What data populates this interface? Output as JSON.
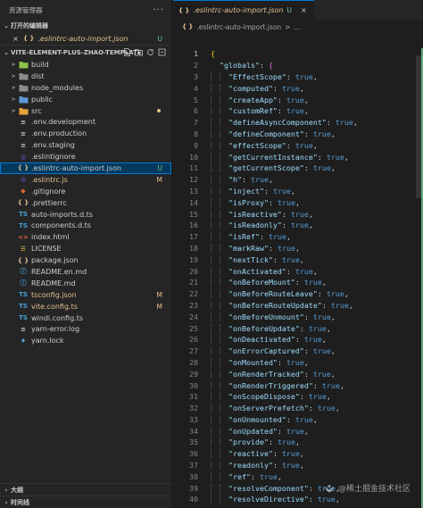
{
  "sidebar": {
    "title": "资源管理器",
    "more": "···",
    "open_editors_header": "打开的编辑器",
    "open_editors": [
      {
        "close": "×",
        "icon": "{ }",
        "label": ".eslintrc-auto-import.json",
        "badge": "U"
      }
    ],
    "project_header": "VITE-ELEMENT-PLUS-ZHAO-TEMPLATE",
    "tree": [
      {
        "label": "build",
        "type": "folder",
        "icon_color": "#8dc149",
        "arrow": ">"
      },
      {
        "label": "dist",
        "type": "folder",
        "icon_color": "#8c8c8c",
        "arrow": ">"
      },
      {
        "label": "node_modules",
        "type": "folder",
        "icon_color": "#8c8c8c",
        "arrow": ">"
      },
      {
        "label": "public",
        "type": "folder",
        "icon_color": "#5d9bd6",
        "arrow": ">"
      },
      {
        "label": "src",
        "type": "folder",
        "icon_color": "#e8a13c",
        "arrow": ">",
        "dot": true
      },
      {
        "label": ".env.development",
        "icon": "≡",
        "icon_color": "#cccccc"
      },
      {
        "label": ".env.production",
        "icon": "≡",
        "icon_color": "#cccccc"
      },
      {
        "label": ".env.staging",
        "icon": "≡",
        "icon_color": "#cccccc"
      },
      {
        "label": ".eslintignore",
        "icon": "◎",
        "icon_color": "#7b68ee"
      },
      {
        "label": ".eslintrc-auto-import.json",
        "icon": "{ }",
        "icon_color": "#e2c08d",
        "badge": "U",
        "selected": true
      },
      {
        "label": ".eslintrc.js",
        "icon": "◎",
        "icon_color": "#7b68ee",
        "badge": "M",
        "label_color": "#e2c08d"
      },
      {
        "label": ".gitignore",
        "icon": "◆",
        "icon_color": "#e8643c"
      },
      {
        "label": ".prettierrc",
        "icon": "{ }",
        "icon_color": "#e2c08d"
      },
      {
        "label": "auto-imports.d.ts",
        "icon": "TS",
        "icon_color": "#4a9fd6"
      },
      {
        "label": "components.d.ts",
        "icon": "TS",
        "icon_color": "#4a9fd6"
      },
      {
        "label": "index.html",
        "icon": "<>",
        "icon_color": "#e8643c"
      },
      {
        "label": "LICENSE",
        "icon": "☰",
        "icon_color": "#d8b448"
      },
      {
        "label": "package.json",
        "icon": "{ }",
        "icon_color": "#e2c08d"
      },
      {
        "label": "README.en.md",
        "icon": "ⓘ",
        "icon_color": "#4a9fd6"
      },
      {
        "label": "README.md",
        "icon": "ⓘ",
        "icon_color": "#4a9fd6"
      },
      {
        "label": "tsconfig.json",
        "icon": "TS",
        "icon_color": "#4a9fd6",
        "badge": "M",
        "label_color": "#e2c08d"
      },
      {
        "label": "vite.config.ts",
        "icon": "TS",
        "icon_color": "#4a9fd6",
        "badge": "M",
        "label_color": "#e2c08d"
      },
      {
        "label": "windi.config.ts",
        "icon": "TS",
        "icon_color": "#4a9fd6"
      },
      {
        "label": "yarn-error.log",
        "icon": "≡",
        "icon_color": "#cccccc"
      },
      {
        "label": "yarn.lock",
        "icon": "♦",
        "icon_color": "#4a9fd6"
      }
    ],
    "outline_header": "大纲",
    "timeline_header": "时间线"
  },
  "editor": {
    "tab": {
      "icon": "{ }",
      "label": ".eslintrc-auto-import.json",
      "badge": "U",
      "close": "×"
    },
    "breadcrumb": {
      "icon": "{ }",
      "label": ".eslintrc-auto-import.json",
      "sep": ">",
      "tail": "..."
    },
    "active_line": 1,
    "lines": [
      {
        "n": 1,
        "open": "{"
      },
      {
        "n": 2,
        "key": "\"globals\"",
        "open2": "{"
      },
      {
        "n": 3,
        "key": "\"EffectScope\"",
        "val": "true"
      },
      {
        "n": 4,
        "key": "\"computed\"",
        "val": "true"
      },
      {
        "n": 5,
        "key": "\"createApp\"",
        "val": "true"
      },
      {
        "n": 6,
        "key": "\"customRef\"",
        "val": "true"
      },
      {
        "n": 7,
        "key": "\"defineAsyncComponent\"",
        "val": "true"
      },
      {
        "n": 8,
        "key": "\"defineComponent\"",
        "val": "true"
      },
      {
        "n": 9,
        "key": "\"effectScope\"",
        "val": "true"
      },
      {
        "n": 10,
        "key": "\"getCurrentInstance\"",
        "val": "true"
      },
      {
        "n": 11,
        "key": "\"getCurrentScope\"",
        "val": "true"
      },
      {
        "n": 12,
        "key": "\"h\"",
        "val": "true"
      },
      {
        "n": 13,
        "key": "\"inject\"",
        "val": "true"
      },
      {
        "n": 14,
        "key": "\"isProxy\"",
        "val": "true"
      },
      {
        "n": 15,
        "key": "\"isReactive\"",
        "val": "true"
      },
      {
        "n": 16,
        "key": "\"isReadonly\"",
        "val": "true"
      },
      {
        "n": 17,
        "key": "\"isRef\"",
        "val": "true"
      },
      {
        "n": 18,
        "key": "\"markRaw\"",
        "val": "true"
      },
      {
        "n": 19,
        "key": "\"nextTick\"",
        "val": "true"
      },
      {
        "n": 20,
        "key": "\"onActivated\"",
        "val": "true"
      },
      {
        "n": 21,
        "key": "\"onBeforeMount\"",
        "val": "true"
      },
      {
        "n": 22,
        "key": "\"onBeforeRouteLeave\"",
        "val": "true"
      },
      {
        "n": 23,
        "key": "\"onBeforeRouteUpdate\"",
        "val": "true"
      },
      {
        "n": 24,
        "key": "\"onBeforeUnmount\"",
        "val": "true"
      },
      {
        "n": 25,
        "key": "\"onBeforeUpdate\"",
        "val": "true"
      },
      {
        "n": 26,
        "key": "\"onDeactivated\"",
        "val": "true"
      },
      {
        "n": 27,
        "key": "\"onErrorCaptured\"",
        "val": "true"
      },
      {
        "n": 28,
        "key": "\"onMounted\"",
        "val": "true"
      },
      {
        "n": 29,
        "key": "\"onRenderTracked\"",
        "val": "true"
      },
      {
        "n": 30,
        "key": "\"onRenderTriggered\"",
        "val": "true"
      },
      {
        "n": 31,
        "key": "\"onScopeDispose\"",
        "val": "true"
      },
      {
        "n": 32,
        "key": "\"onServerPrefetch\"",
        "val": "true"
      },
      {
        "n": 33,
        "key": "\"onUnmounted\"",
        "val": "true"
      },
      {
        "n": 34,
        "key": "\"onUpdated\"",
        "val": "true"
      },
      {
        "n": 35,
        "key": "\"provide\"",
        "val": "true"
      },
      {
        "n": 36,
        "key": "\"reactive\"",
        "val": "true"
      },
      {
        "n": 37,
        "key": "\"readonly\"",
        "val": "true"
      },
      {
        "n": 38,
        "key": "\"ref\"",
        "val": "true"
      },
      {
        "n": 39,
        "key": "\"resolveComponent\"",
        "val": "true"
      },
      {
        "n": 40,
        "key": "\"resolveDirective\"",
        "val": "true"
      }
    ]
  },
  "watermark": {
    "text": "@稀土掘金技术社区"
  },
  "colors": {
    "untracked": "#73c991",
    "modified": "#e2c08d",
    "selection": "#04395e",
    "accent": "#0078d4"
  }
}
